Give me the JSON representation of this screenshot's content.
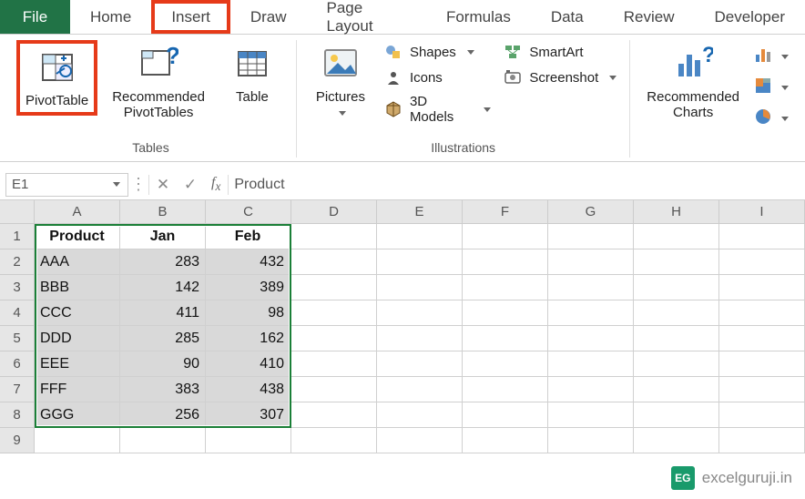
{
  "tabs": {
    "file": "File",
    "home": "Home",
    "insert": "Insert",
    "draw": "Draw",
    "page_layout": "Page Layout",
    "formulas": "Formulas",
    "data": "Data",
    "review": "Review",
    "developer": "Developer"
  },
  "ribbon": {
    "tables": {
      "label": "Tables",
      "pivottable": "PivotTable",
      "recommended_pt": "Recommended\nPivotTables",
      "table": "Table"
    },
    "illustrations": {
      "label": "Illustrations",
      "pictures": "Pictures",
      "shapes": "Shapes",
      "icons": "Icons",
      "models": "3D Models",
      "smartart": "SmartArt",
      "screenshot": "Screenshot"
    },
    "charts": {
      "recommended": "Recommended\nCharts"
    }
  },
  "fx": {
    "namebox": "E1",
    "value": "Product"
  },
  "grid": {
    "cols": [
      "A",
      "B",
      "C",
      "D",
      "E",
      "F",
      "G",
      "H",
      "I"
    ],
    "rows": [
      "1",
      "2",
      "3",
      "4",
      "5",
      "6",
      "7",
      "8",
      "9"
    ]
  },
  "chart_data": {
    "type": "table",
    "headers": [
      "Product",
      "Jan",
      "Feb"
    ],
    "rows": [
      [
        "AAA",
        283,
        432
      ],
      [
        "BBB",
        142,
        389
      ],
      [
        "CCC",
        411,
        98
      ],
      [
        "DDD",
        285,
        162
      ],
      [
        "EEE",
        90,
        410
      ],
      [
        "FFF",
        383,
        438
      ],
      [
        "GGG",
        256,
        307
      ]
    ]
  },
  "watermark": "excelguruji.in",
  "watermark_logo": "EG"
}
